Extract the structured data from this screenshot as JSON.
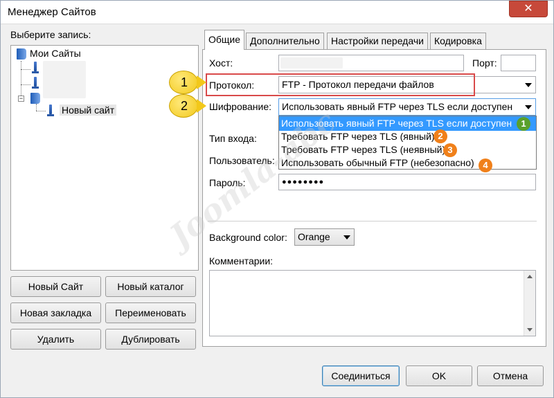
{
  "window": {
    "title": "Менеджер Сайтов",
    "close_glyph": "✕"
  },
  "left": {
    "select_label": "Выберите запись:",
    "tree": {
      "root": "Мои Сайты",
      "new_site": "Новый сайт"
    },
    "buttons": {
      "new_site": "Новый Сайт",
      "new_folder": "Новый каталог",
      "new_bookmark": "Новая закладка",
      "rename": "Переименовать",
      "delete": "Удалить",
      "duplicate": "Дублировать"
    }
  },
  "tabs": [
    "Общие",
    "Дополнительно",
    "Настройки передачи",
    "Кодировка"
  ],
  "general": {
    "host_label": "Хост:",
    "port_label": "Порт:",
    "host_value": "",
    "port_value": "",
    "protocol_label": "Протокол:",
    "protocol_value": "FTP - Протокол передачи файлов",
    "encryption_label": "Шифрование:",
    "encryption_value": "Использовать явный FTP через TLS если доступен",
    "encryption_options": [
      "Использовать явный FTP через TLS если доступен",
      "Требовать FTP через TLS (явный)",
      "Требовать FTP через TLS (неявный)",
      "Использовать обычный FTP (небезопасно)"
    ],
    "login_type_label": "Тип входа:",
    "user_label": "Пользователь:",
    "password_label": "Пароль:",
    "password_value": "●●●●●●●●",
    "bg_color_label": "Background color:",
    "bg_color_value": "Orange",
    "comments_label": "Комментарии:"
  },
  "callouts": [
    "1",
    "2"
  ],
  "badges": [
    {
      "num": "1",
      "color": "#5aa02c"
    },
    {
      "num": "2",
      "color": "#f0801a"
    },
    {
      "num": "3",
      "color": "#f0801a"
    },
    {
      "num": "4",
      "color": "#f0801a"
    }
  ],
  "watermark": "Joomla-abc",
  "footer": {
    "connect": "Соединиться",
    "ok": "OK",
    "cancel": "Отмена"
  }
}
